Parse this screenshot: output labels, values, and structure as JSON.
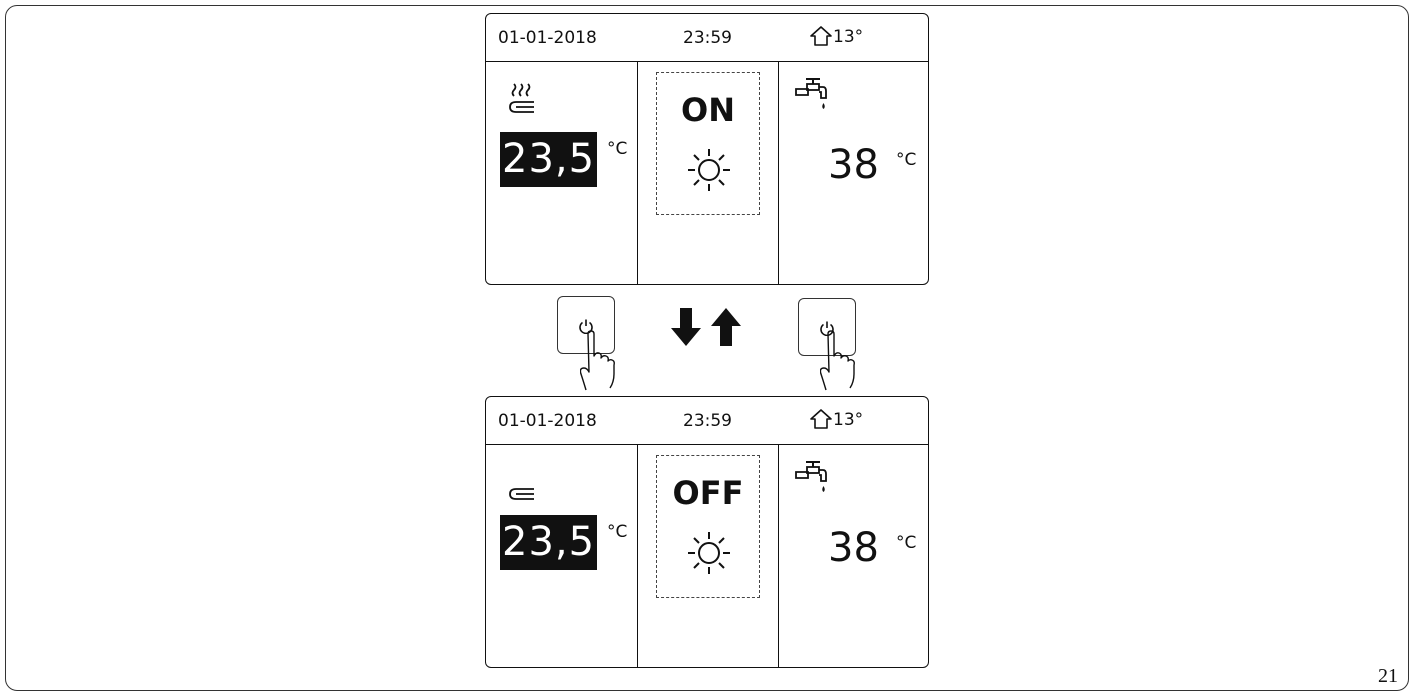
{
  "screens": [
    {
      "id": "on",
      "status_bar": {
        "date": "01-01-2018",
        "time": "23:59",
        "outdoor_temp": "13°"
      },
      "space_zone": {
        "icon": "floor-heating-on-icon",
        "temperature": "23,5",
        "unit": "°C"
      },
      "mode": {
        "state": "ON",
        "icon": "sun-icon"
      },
      "dhw": {
        "icon": "tap-icon",
        "temperature": "38",
        "unit": "°C"
      }
    },
    {
      "id": "off",
      "status_bar": {
        "date": "01-01-2018",
        "time": "23:59",
        "outdoor_temp": "13°"
      },
      "space_zone": {
        "icon": "floor-heating-off-icon",
        "temperature": "23,5",
        "unit": "°C"
      },
      "mode": {
        "state": "OFF",
        "icon": "sun-icon"
      },
      "dhw": {
        "icon": "tap-icon",
        "temperature": "38",
        "unit": "°C"
      }
    }
  ],
  "controls": {
    "left_button_icon": "power-icon",
    "right_button_icon": "power-icon",
    "arrows": [
      "down-arrow-icon",
      "up-arrow-icon"
    ]
  },
  "page_number": "21"
}
